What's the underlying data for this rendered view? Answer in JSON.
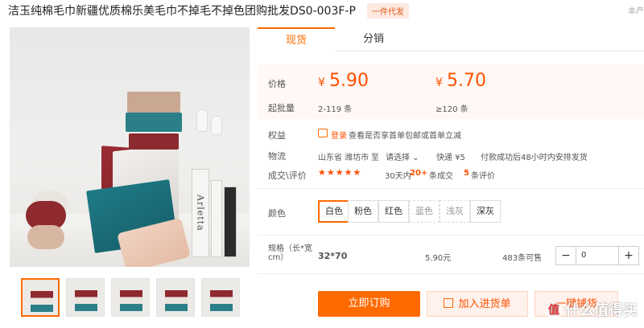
{
  "header": {
    "title": "洁玉纯棉毛巾新疆优质棉乐美毛巾不掉毛不掉色团购批发DS0-003F-P",
    "badge": "一件代发",
    "right_text": "本产"
  },
  "gallery": {
    "book_title": "Arletta",
    "thumbnail_count": 5
  },
  "tabs": [
    {
      "label": "现货",
      "active": true
    },
    {
      "label": "分销",
      "active": false
    }
  ],
  "pricing": {
    "label": "价格",
    "min_qty_label": "起批量",
    "currency": "¥",
    "tiers": [
      {
        "price": "5.90",
        "range": "2-119 条"
      },
      {
        "price": "5.70",
        "range": "≥120 条"
      }
    ]
  },
  "benefits": {
    "label": "权益",
    "login": "登录",
    "text": "查看是否享首单包邮或首单立减"
  },
  "logistics": {
    "label": "物流",
    "origin": "山东省 潍坊市",
    "to": "至",
    "select": "请选择",
    "express": "快递 ¥5",
    "ship_time": "付款成功后48小时内安排发货"
  },
  "reviews": {
    "label": "成交\\评价",
    "stars": "★★★★★",
    "days_text": "30天内",
    "deals": "20+",
    "deals_unit": "条成交",
    "review_count": "5",
    "review_unit": "条评价"
  },
  "colors": {
    "label": "颜色",
    "options": [
      {
        "name": "白色",
        "state": "active"
      },
      {
        "name": "粉色",
        "state": "normal"
      },
      {
        "name": "红色",
        "state": "normal"
      },
      {
        "name": "蓝色",
        "state": "disabled"
      },
      {
        "name": "浅灰",
        "state": "disabled"
      },
      {
        "name": "深灰",
        "state": "normal"
      }
    ]
  },
  "spec": {
    "label": "规格（长*宽cm）",
    "value": "32*70",
    "price": "5.90元",
    "stock": "483条可售",
    "quantity": "0"
  },
  "actions": {
    "order_now": "立即订购",
    "add_to_cart": "加入进货单",
    "dropship": "一键铺货"
  },
  "watermark": {
    "icon": "值",
    "text": "什么值得买"
  },
  "colors_theme": {
    "accent": "#ff6a00",
    "price": "#ff5000"
  }
}
